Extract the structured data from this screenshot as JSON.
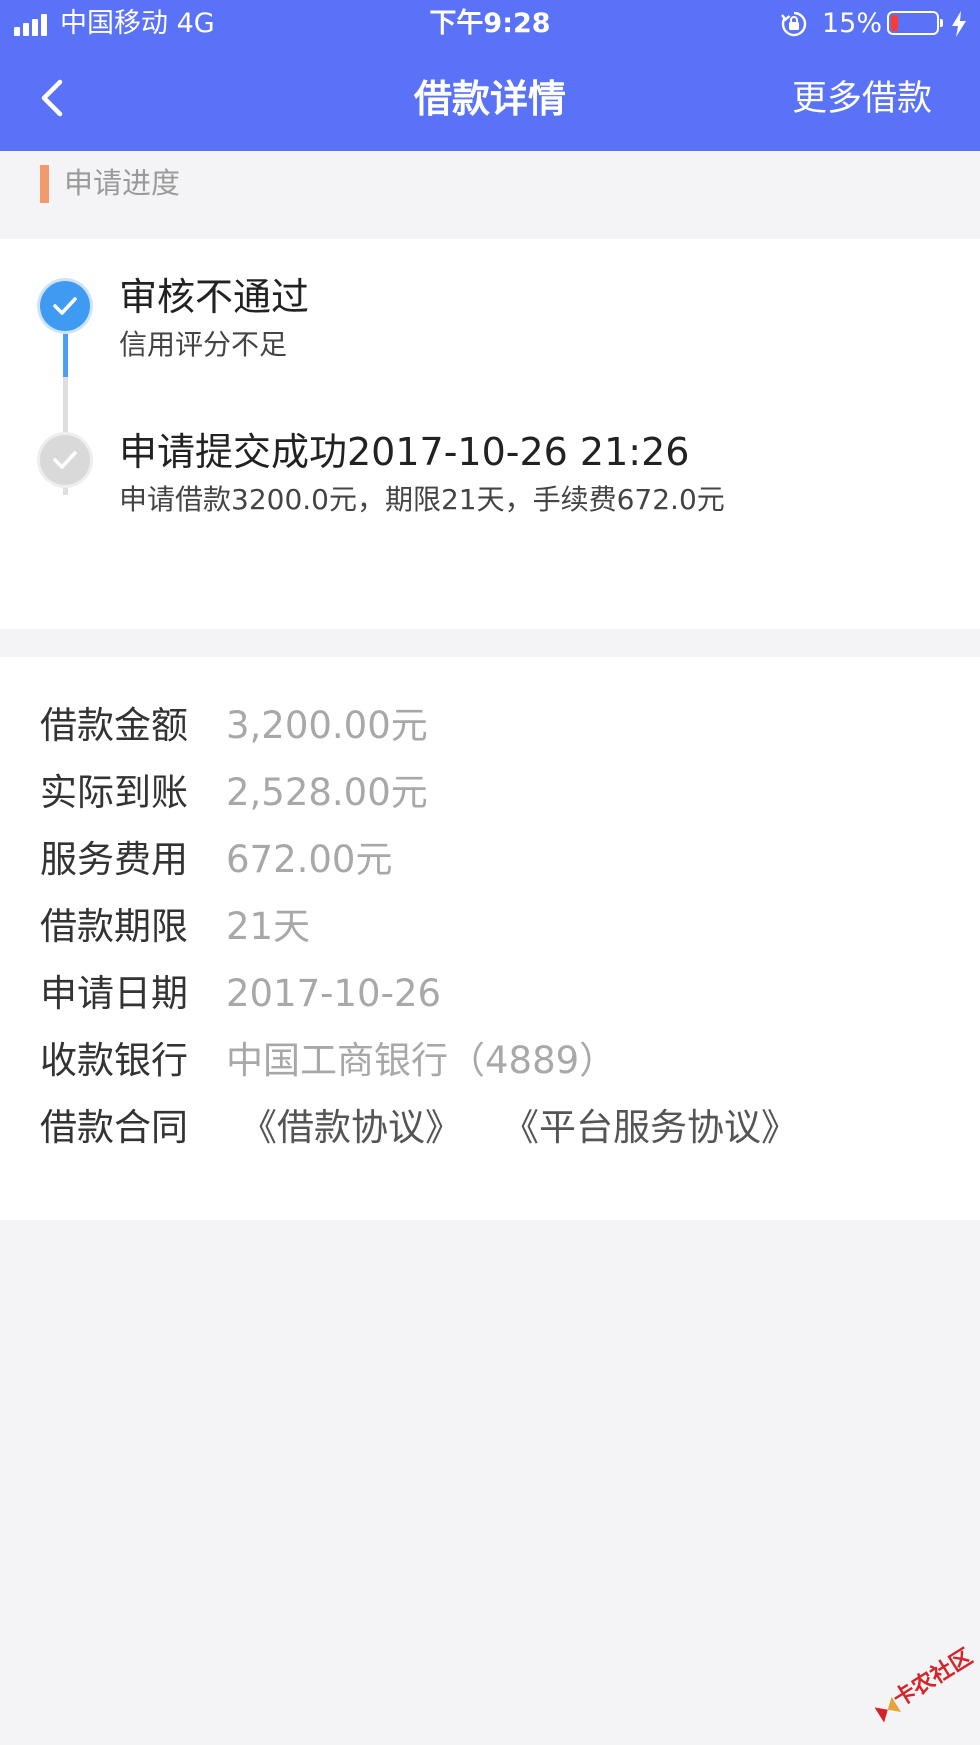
{
  "status_bar": {
    "carrier": "中国移动   4G",
    "time": "下午9:28",
    "battery_percent": "15%",
    "battery_level": 0.15,
    "battery_color": "#ff3b30"
  },
  "nav": {
    "back_icon": "chevron-left-icon",
    "title": "借款详情",
    "more_label": "更多借款",
    "background_color": "#5a72f7"
  },
  "section": {
    "title": "申请进度",
    "accent_color": "#f29a6c"
  },
  "progress": {
    "steps": [
      {
        "title": "审核不通过",
        "subtitle": "信用评分不足",
        "state": "active",
        "icon": "checkmark-icon",
        "color": "#3f9af2"
      },
      {
        "title": "申请提交成功2017-10-26 21:26",
        "subtitle": "申请借款3200.0元，期限21天，手续费672.0元",
        "state": "inactive",
        "icon": "checkmark-icon",
        "color": "#d9d9d9"
      }
    ]
  },
  "details": {
    "rows": [
      {
        "label": "借款金额",
        "value": "3,200.00元"
      },
      {
        "label": "实际到账",
        "value": "2,528.00元"
      },
      {
        "label": "服务费用",
        "value": "672.00元"
      },
      {
        "label": "借款期限",
        "value": "21天"
      },
      {
        "label": "申请日期",
        "value": "2017-10-26"
      },
      {
        "label": "收款银行",
        "value": "中国工商银行（4889）"
      }
    ],
    "contract": {
      "label": "借款合同",
      "links": [
        "《借款协议》",
        "《平台服务协议》"
      ]
    }
  },
  "watermark": {
    "text": "卡农社区",
    "icon": "logo-mark-icon",
    "color": "#d4232a"
  }
}
